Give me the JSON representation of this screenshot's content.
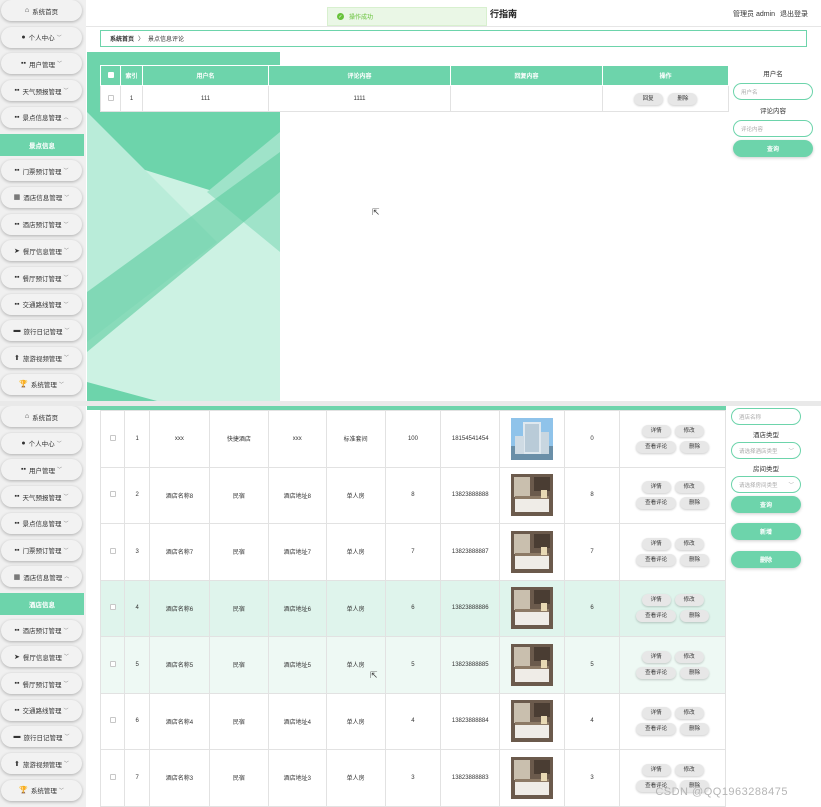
{
  "top": {
    "sidebar": {
      "items": [
        {
          "label": "系统首页",
          "icon": "home-icon",
          "glyph": "⌂",
          "chev": ""
        },
        {
          "label": "个人中心",
          "icon": "user-icon",
          "glyph": "●",
          "chev": "﹀"
        },
        {
          "label": "用户管理",
          "icon": "grid-icon",
          "glyph": "▪▪",
          "chev": "﹀"
        },
        {
          "label": "天气预报管理",
          "icon": "grid-icon",
          "glyph": "▪▪",
          "chev": "﹀"
        },
        {
          "label": "景点信息管理",
          "icon": "grid-icon",
          "glyph": "▪▪",
          "chev": "︿"
        }
      ],
      "active": "景点信息",
      "items2": [
        {
          "label": "门票预订管理",
          "icon": "grid-icon",
          "glyph": "▪▪",
          "chev": "﹀"
        },
        {
          "label": "酒店信息管理",
          "icon": "calendar-icon",
          "glyph": "▦",
          "chev": "﹀"
        },
        {
          "label": "酒店预订管理",
          "icon": "grid-icon",
          "glyph": "▪▪",
          "chev": "﹀"
        },
        {
          "label": "餐厅信息管理",
          "icon": "send-icon",
          "glyph": "➤",
          "chev": "﹀"
        },
        {
          "label": "餐厅预订管理",
          "icon": "grid-icon",
          "glyph": "▪▪",
          "chev": "﹀"
        },
        {
          "label": "交通路线管理",
          "icon": "grid-icon",
          "glyph": "▪▪",
          "chev": "﹀"
        },
        {
          "label": "旅行日记管理",
          "icon": "monitor-icon",
          "glyph": "▬",
          "chev": "﹀"
        },
        {
          "label": "旅游视频管理",
          "icon": "upload-icon",
          "glyph": "⬆",
          "chev": "﹀"
        },
        {
          "label": "系统管理",
          "icon": "trophy-icon",
          "glyph": "🏆",
          "chev": "﹀"
        }
      ]
    },
    "toast": "操作成功",
    "site_title": "行指南",
    "admin": {
      "role": "管理员 admin",
      "logout": "退出登录"
    },
    "breadcrumb": {
      "home": "系统首页",
      "sep": "〉",
      "current": "景点信息评论"
    },
    "table": {
      "headers": [
        "索引",
        "用户名",
        "评论内容",
        "回复内容",
        "操作"
      ],
      "rows": [
        {
          "index": "1",
          "username": "111",
          "content": "1111",
          "reply": "",
          "actions": [
            "回复",
            "删除"
          ]
        }
      ]
    },
    "search": {
      "label1": "用户名",
      "placeholder1": "用户名",
      "label2": "评论内容",
      "placeholder2": "评论内容",
      "button": "查询"
    }
  },
  "bottom": {
    "sidebar": {
      "items": [
        {
          "label": "系统首页",
          "icon": "home-icon",
          "glyph": "⌂",
          "chev": ""
        },
        {
          "label": "个人中心",
          "icon": "user-icon",
          "glyph": "●",
          "chev": "﹀"
        },
        {
          "label": "用户管理",
          "icon": "grid-icon",
          "glyph": "▪▪",
          "chev": "﹀"
        },
        {
          "label": "天气预报管理",
          "icon": "grid-icon",
          "glyph": "▪▪",
          "chev": "﹀"
        },
        {
          "label": "景点信息管理",
          "icon": "grid-icon",
          "glyph": "▪▪",
          "chev": "﹀"
        },
        {
          "label": "门票预订管理",
          "icon": "grid-icon",
          "glyph": "▪▪",
          "chev": "﹀"
        },
        {
          "label": "酒店信息管理",
          "icon": "calendar-icon",
          "glyph": "▦",
          "chev": "︿"
        }
      ],
      "active": "酒店信息",
      "items2": [
        {
          "label": "酒店预订管理",
          "icon": "grid-icon",
          "glyph": "▪▪",
          "chev": "﹀"
        },
        {
          "label": "餐厅信息管理",
          "icon": "send-icon",
          "glyph": "➤",
          "chev": "﹀"
        },
        {
          "label": "餐厅预订管理",
          "icon": "grid-icon",
          "glyph": "▪▪",
          "chev": "﹀"
        },
        {
          "label": "交通路线管理",
          "icon": "grid-icon",
          "glyph": "▪▪",
          "chev": "﹀"
        },
        {
          "label": "旅行日记管理",
          "icon": "monitor-icon",
          "glyph": "▬",
          "chev": "﹀"
        },
        {
          "label": "旅游视频管理",
          "icon": "upload-icon",
          "glyph": "⬆",
          "chev": "﹀"
        },
        {
          "label": "系统管理",
          "icon": "trophy-icon",
          "glyph": "🏆",
          "chev": "﹀"
        }
      ]
    },
    "table": {
      "rows": [
        {
          "index": "1",
          "name": "xxx",
          "type": "快捷酒店",
          "address": "xxx",
          "room": "标准套间",
          "price": "100",
          "phone": "18154541454",
          "photo": "hotel-building",
          "count": "0",
          "actions": [
            "详情",
            "修改",
            "查看评论",
            "删除"
          ],
          "highlight": ""
        },
        {
          "index": "2",
          "name": "酒店名称8",
          "type": "民宿",
          "address": "酒店地址8",
          "room": "单人房",
          "price": "8",
          "phone": "13823888888",
          "photo": "room",
          "count": "8",
          "actions": [
            "详情",
            "修改",
            "查看评论",
            "删除"
          ],
          "highlight": ""
        },
        {
          "index": "3",
          "name": "酒店名称7",
          "type": "民宿",
          "address": "酒店地址7",
          "room": "单人房",
          "price": "7",
          "phone": "13823888887",
          "photo": "room",
          "count": "7",
          "actions": [
            "详情",
            "修改",
            "查看评论",
            "删除"
          ],
          "highlight": ""
        },
        {
          "index": "4",
          "name": "酒店名称6",
          "type": "民宿",
          "address": "酒店地址6",
          "room": "单人房",
          "price": "6",
          "phone": "13823888886",
          "photo": "room",
          "count": "6",
          "actions": [
            "详情",
            "修改",
            "查看评论",
            "删除"
          ],
          "highlight": "strong"
        },
        {
          "index": "5",
          "name": "酒店名称5",
          "type": "民宿",
          "address": "酒店地址5",
          "room": "单人房",
          "price": "5",
          "phone": "13823888885",
          "photo": "room",
          "count": "5",
          "actions": [
            "详情",
            "修改",
            "查看评论",
            "删除"
          ],
          "highlight": "light"
        },
        {
          "index": "6",
          "name": "酒店名称4",
          "type": "民宿",
          "address": "酒店地址4",
          "room": "单人房",
          "price": "4",
          "phone": "13823888884",
          "photo": "room",
          "count": "4",
          "actions": [
            "详情",
            "修改",
            "查看评论",
            "删除"
          ],
          "highlight": ""
        },
        {
          "index": "7",
          "name": "酒店名称3",
          "type": "民宿",
          "address": "酒店地址3",
          "room": "单人房",
          "price": "3",
          "phone": "13823888883",
          "photo": "room",
          "count": "3",
          "actions": [
            "详情",
            "修改",
            "查看评论",
            "删除"
          ],
          "highlight": ""
        }
      ]
    },
    "search": {
      "placeholder_name": "酒店名称",
      "label_type": "酒店类型",
      "placeholder_type": "请选择酒店类型",
      "label_room": "房间类型",
      "placeholder_room": "请选择房间类型",
      "search_button": "查询",
      "add_button": "新增",
      "delete_button": "删除"
    },
    "watermark": "CSDN @QQ1963288475"
  },
  "colors": {
    "accent": "#6dd4ab",
    "row_highlight": "#dff4ec",
    "row_highlight_light": "#eef9f4"
  }
}
